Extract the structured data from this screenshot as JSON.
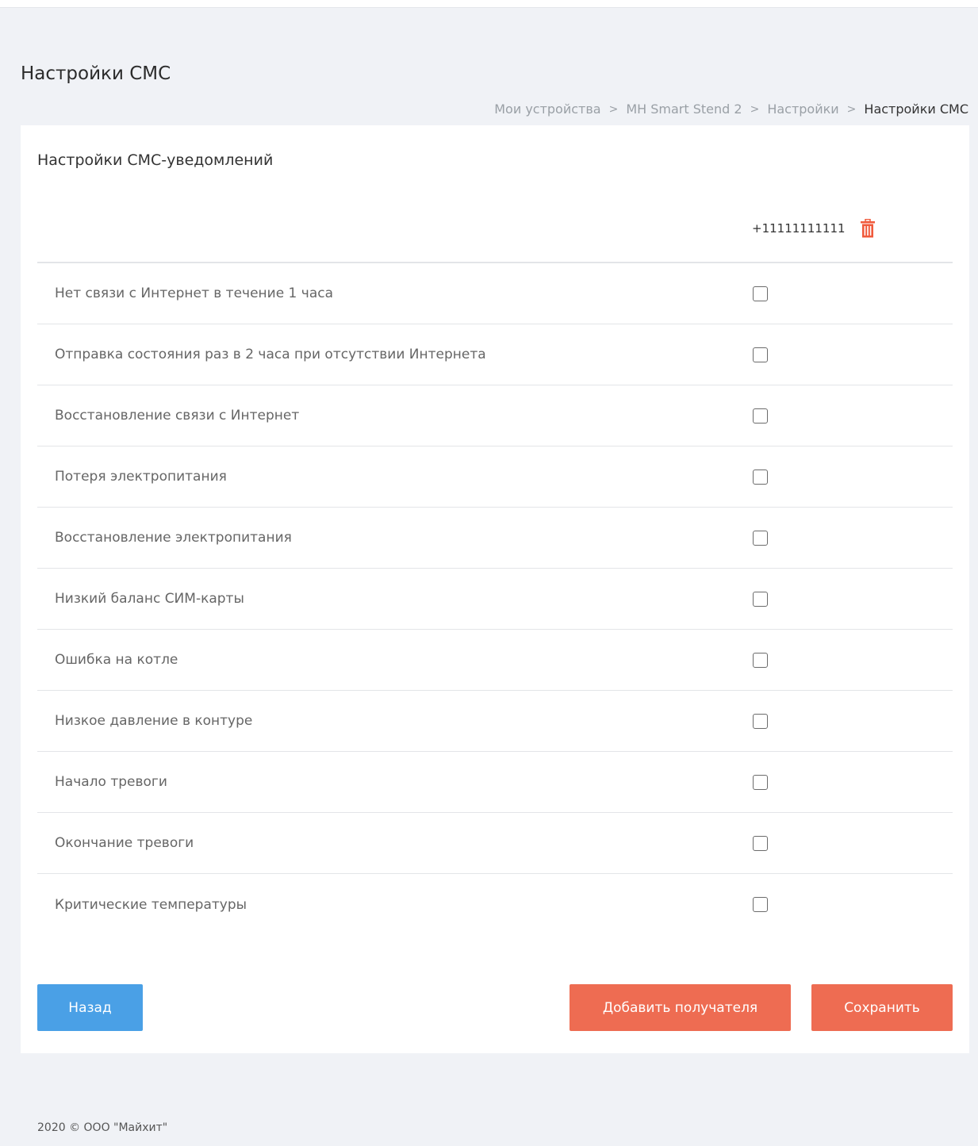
{
  "page": {
    "title": "Настройки СМС"
  },
  "breadcrumb": {
    "items": [
      "Мои устройства",
      "MH Smart Stend 2",
      "Настройки"
    ],
    "current": "Настройки СМС",
    "separator": ">"
  },
  "card": {
    "title": "Настройки СМС-уведомлений",
    "recipient_phone": "+11111111111",
    "delete_icon": "trash-icon"
  },
  "notifications": [
    {
      "label": "Нет связи с Интернет в течение 1 часа",
      "checked": false
    },
    {
      "label": "Отправка состояния раз в 2 часа при отсутствии Интернета",
      "checked": false
    },
    {
      "label": "Восстановление связи с Интернет",
      "checked": false
    },
    {
      "label": "Потеря электропитания",
      "checked": false
    },
    {
      "label": "Восстановление электропитания",
      "checked": false
    },
    {
      "label": "Низкий баланс СИМ-карты",
      "checked": false
    },
    {
      "label": "Ошибка на котле",
      "checked": false
    },
    {
      "label": "Низкое давление в контуре",
      "checked": false
    },
    {
      "label": "Начало тревоги",
      "checked": false
    },
    {
      "label": "Окончание тревоги",
      "checked": false
    },
    {
      "label": "Критические температуры",
      "checked": false
    }
  ],
  "buttons": {
    "back": "Назад",
    "add_recipient": "Добавить получателя",
    "save": "Сохранить"
  },
  "footer": {
    "text": "2020 © ООО \"Майхит\""
  },
  "colors": {
    "background": "#f0f2f6",
    "primary_blue": "#4aa0e6",
    "accent_red": "#ee6c52",
    "trash_red": "#f05a3c"
  }
}
